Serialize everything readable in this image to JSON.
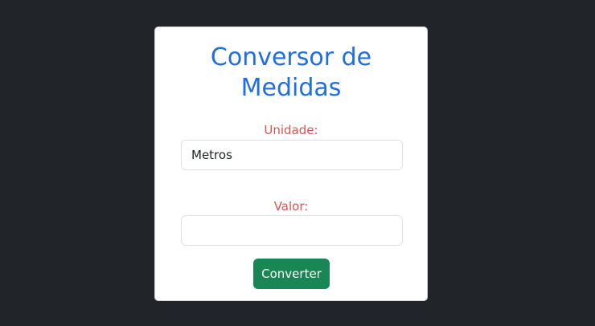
{
  "colors": {
    "background": "#212529",
    "card": "#ffffff",
    "title": "#1f6fe0",
    "label": "#d9534f",
    "button": "#198754"
  },
  "form": {
    "title_line1": "Conversor de",
    "title_line2": "Medidas",
    "unidade_label": "Unidade:",
    "unidade_value": "Metros",
    "valor_label": "Valor:",
    "valor_value": "",
    "submit_label": "Converter"
  }
}
